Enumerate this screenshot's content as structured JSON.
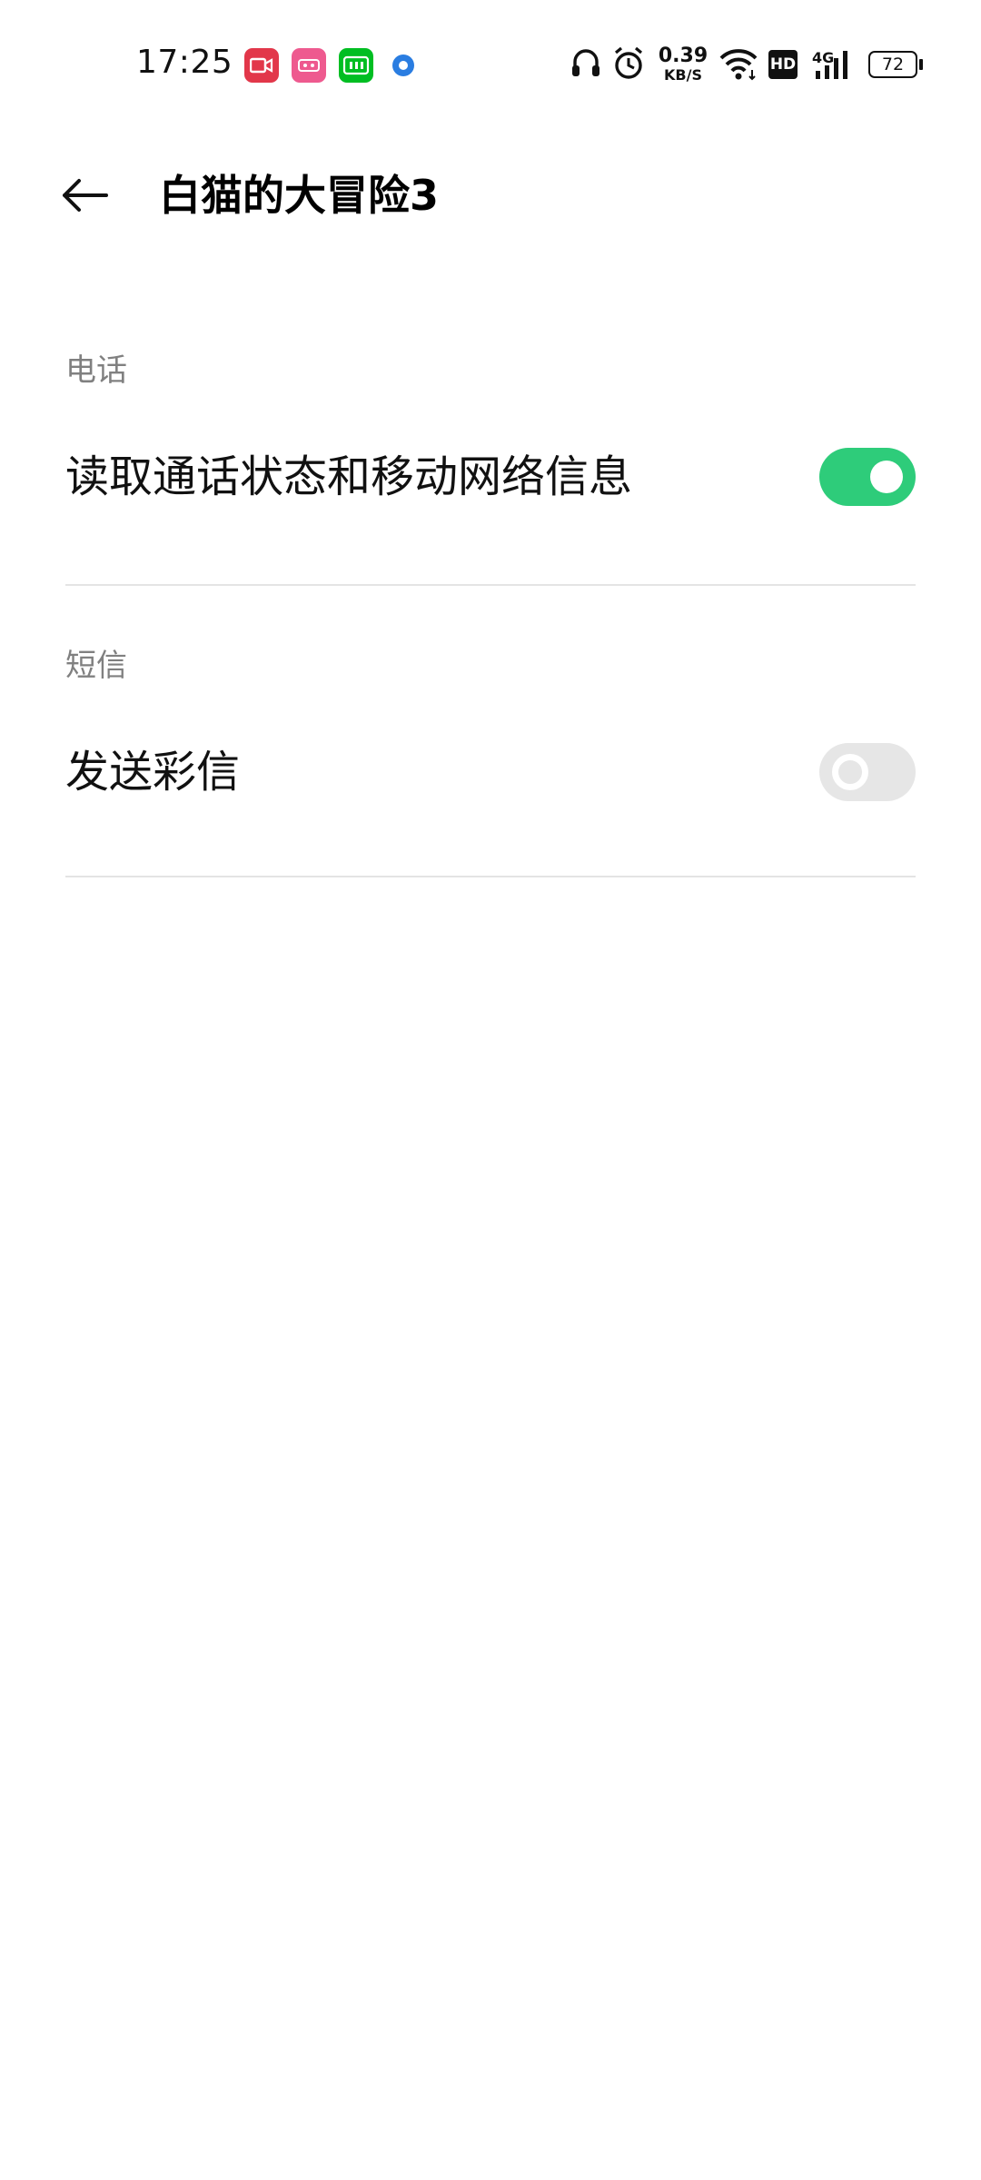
{
  "status_bar": {
    "time": "17:25",
    "net_speed_value": "0.39",
    "net_speed_unit": "KB/S",
    "hd_label": "HD",
    "network_type": "4G",
    "battery": "72",
    "icons": [
      "video-app-icon",
      "pink-app-icon",
      "iqiyi-app-icon",
      "blue-dot-app-icon",
      "headphones-icon",
      "alarm-icon",
      "wifi-icon",
      "hd-icon",
      "signal-icon",
      "battery-icon"
    ]
  },
  "header": {
    "title": "白猫的大冒险3"
  },
  "sections": [
    {
      "title": "电话",
      "items": [
        {
          "label": "读取通话状态和移动网络信息",
          "enabled": true
        }
      ]
    },
    {
      "title": "短信",
      "items": [
        {
          "label": "发送彩信",
          "enabled": false
        }
      ]
    }
  ],
  "colors": {
    "switch_on": "#2ecc7a",
    "switch_off": "#e6e6e6",
    "section_title": "#808080",
    "divider": "#e4e4e4"
  }
}
